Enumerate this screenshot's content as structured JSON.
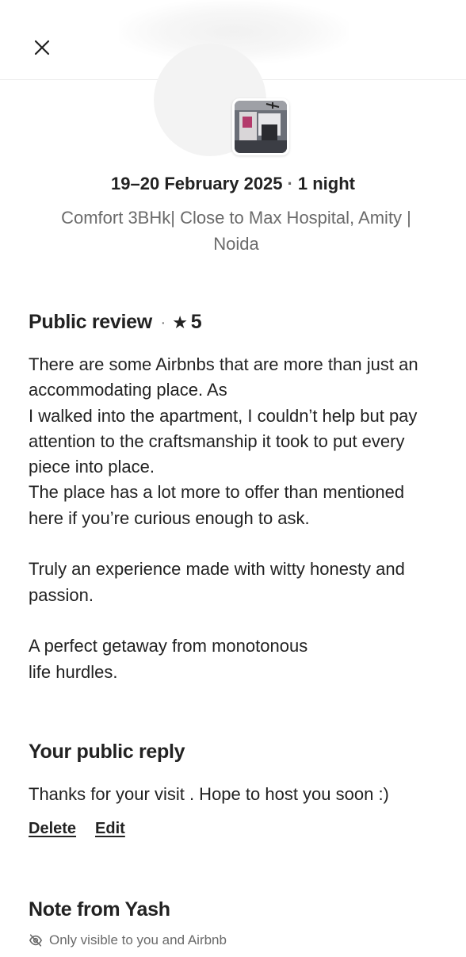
{
  "header": {
    "close_icon": "close-icon"
  },
  "trip": {
    "dates": "19–20 February 2025",
    "separator": "·",
    "nights": "1 night",
    "listing_title": "Comfort 3BHk| Close to Max Hospital, Amity | Noida"
  },
  "public_review": {
    "title": "Public review",
    "separator": "·",
    "star_icon": "star-icon",
    "rating": "5",
    "text": "There are some Airbnbs that are more than just an accommodating place. As\nI walked into the apartment, I couldn’t help but pay attention to the craftsmanship it took to put every piece into place.\nThe place has a lot more to offer than mentioned here if you’re curious enough to ask.\n\nTruly an experience made with witty honesty and passion.\n\nA perfect getaway from monotonous\nlife hurdles."
  },
  "public_reply": {
    "title": "Your public reply",
    "text": "Thanks for your visit . Hope to host you soon :)",
    "delete_label": "Delete",
    "edit_label": "Edit"
  },
  "note": {
    "title": "Note from Yash",
    "visibility_icon": "eye-off-icon",
    "visibility_text": "Only visible to you and Airbnb"
  }
}
